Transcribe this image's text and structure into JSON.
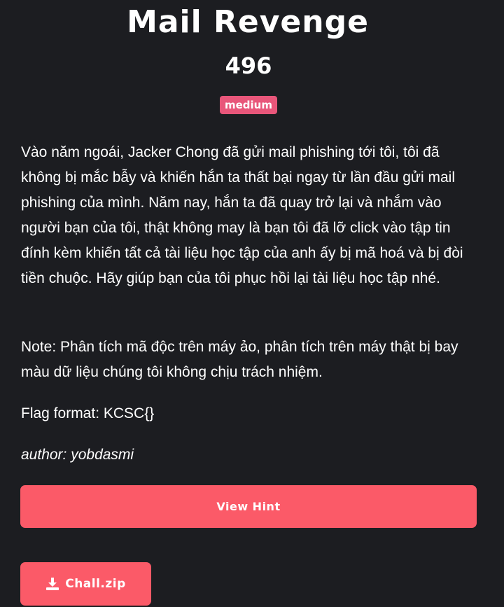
{
  "challenge": {
    "title": "Mail Revenge",
    "points": "496",
    "difficulty": "medium",
    "description": "Vào năm ngoái, Jacker Chong đã gửi mail phishing tới tôi, tôi đã không bị mắc bẫy và khiến hắn ta thất bại ngay từ lần đầu gửi mail phishing của mình. Năm nay, hắn ta đã quay trở lại và nhắm vào người bạn của tôi, thật không may là bạn tôi đã lỡ click vào tập tin đính kèm khiến tất cả tài liệu học tập của anh ấy bị mã hoá và bị đòi tiền chuộc. Hãy giúp bạn của tôi phục hồi lại tài liệu học tập nhé.",
    "note": "Note: Phân tích mã độc trên máy ảo, phân tích trên máy thật bị bay màu dữ liệu chúng tôi không chịu trách nhiệm.",
    "flag_format": "Flag format: KCSC{}",
    "author": "author: yobdasmi"
  },
  "actions": {
    "hint_label": "View Hint",
    "download_label": "Chall.zip",
    "download_icon": "download-icon"
  },
  "colors": {
    "background": "#1c1d21",
    "accent": "#fb5a68",
    "badge": "#e8567a",
    "text": "#ffffff"
  }
}
